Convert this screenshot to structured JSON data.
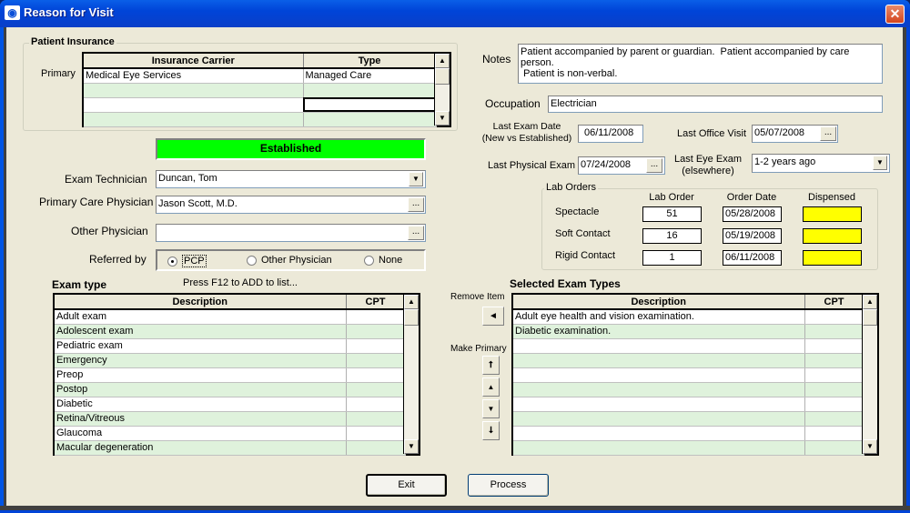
{
  "window": {
    "title": "Reason for Visit",
    "icon": "eye-icon",
    "close_label": "✕"
  },
  "insurance": {
    "group_title": "Patient Insurance",
    "row_label": "Primary",
    "columns": [
      "Insurance Carrier",
      "Type"
    ],
    "rows": [
      {
        "carrier": "Medical Eye Services",
        "type": "Managed Care"
      },
      {
        "carrier": "",
        "type": ""
      },
      {
        "carrier": "",
        "type": ""
      },
      {
        "carrier": "",
        "type": ""
      }
    ]
  },
  "status": {
    "label": "Established",
    "color": "#00ff00"
  },
  "exam_technician": {
    "label": "Exam Technician",
    "value": "Duncan, Tom"
  },
  "primary_care_physician": {
    "label": "Primary Care Physician",
    "value": "Jason Scott, M.D."
  },
  "other_physician": {
    "label": "Other Physician",
    "value": ""
  },
  "referred_by": {
    "label": "Referred by",
    "options": [
      "PCP",
      "Other Physician",
      "None"
    ],
    "selected": "PCP"
  },
  "notes": {
    "label": "Notes",
    "value": "Patient accompanied by parent or guardian.  Patient accompanied by care person.\n Patient is non-verbal."
  },
  "occupation": {
    "label": "Occupation",
    "value": "Electrician"
  },
  "last_exam_date": {
    "label_line1": "Last Exam Date",
    "label_line2": "(New vs Established)",
    "value": "06/11/2008"
  },
  "last_office_visit": {
    "label": "Last Office Visit",
    "value": "05/07/2008"
  },
  "last_physical_exam": {
    "label": "Last Physical Exam",
    "value": "07/24/2008"
  },
  "last_eye_exam": {
    "label_line1": "Last Eye Exam",
    "label_line2": "(elsewhere)",
    "value": "1-2 years ago"
  },
  "lab_orders": {
    "group_title": "Lab Orders",
    "columns": [
      "Lab Order",
      "Order Date",
      "Dispensed"
    ],
    "rows": [
      {
        "name": "Spectacle",
        "lab_order": "51",
        "order_date": "05/28/2008",
        "dispensed_color": "#ffff00"
      },
      {
        "name": "Soft Contact",
        "lab_order": "16",
        "order_date": "05/19/2008",
        "dispensed_color": "#ffff00"
      },
      {
        "name": "Rigid Contact",
        "lab_order": "1",
        "order_date": "06/11/2008",
        "dispensed_color": "#ffff00"
      }
    ]
  },
  "exam_type": {
    "title": "Exam type",
    "hint": "Press F12 to ADD to list...",
    "columns": [
      "Description",
      "CPT"
    ],
    "rows": [
      {
        "description": "Adult exam",
        "cpt": ""
      },
      {
        "description": "Adolescent exam",
        "cpt": ""
      },
      {
        "description": "Pediatric exam",
        "cpt": ""
      },
      {
        "description": "Emergency",
        "cpt": ""
      },
      {
        "description": "Preop",
        "cpt": ""
      },
      {
        "description": "Postop",
        "cpt": ""
      },
      {
        "description": "Diabetic",
        "cpt": ""
      },
      {
        "description": "Retina/Vitreous",
        "cpt": ""
      },
      {
        "description": "Glaucoma",
        "cpt": ""
      },
      {
        "description": "Macular degeneration",
        "cpt": ""
      }
    ]
  },
  "selected_exam_types": {
    "title": "Selected Exam Types",
    "remove_label": "Remove Item",
    "make_primary_label": "Make Primary",
    "columns": [
      "Description",
      "CPT"
    ],
    "rows": [
      {
        "description": "Adult eye health and vision examination.",
        "cpt": ""
      },
      {
        "description": "Diabetic examination.",
        "cpt": ""
      },
      {
        "description": "",
        "cpt": ""
      },
      {
        "description": "",
        "cpt": ""
      },
      {
        "description": "",
        "cpt": ""
      },
      {
        "description": "",
        "cpt": ""
      },
      {
        "description": "",
        "cpt": ""
      },
      {
        "description": "",
        "cpt": ""
      },
      {
        "description": "",
        "cpt": ""
      },
      {
        "description": "",
        "cpt": ""
      }
    ]
  },
  "buttons": {
    "exit": "Exit",
    "process": "Process"
  },
  "glyphs": {
    "ellipsis": "...",
    "dropdown": "▼",
    "scroll_up": "▲",
    "scroll_down": "▼",
    "remove": "◄",
    "move_top": "⭡",
    "move_up": "▲",
    "move_down": "▼",
    "move_bottom": "⭣"
  }
}
